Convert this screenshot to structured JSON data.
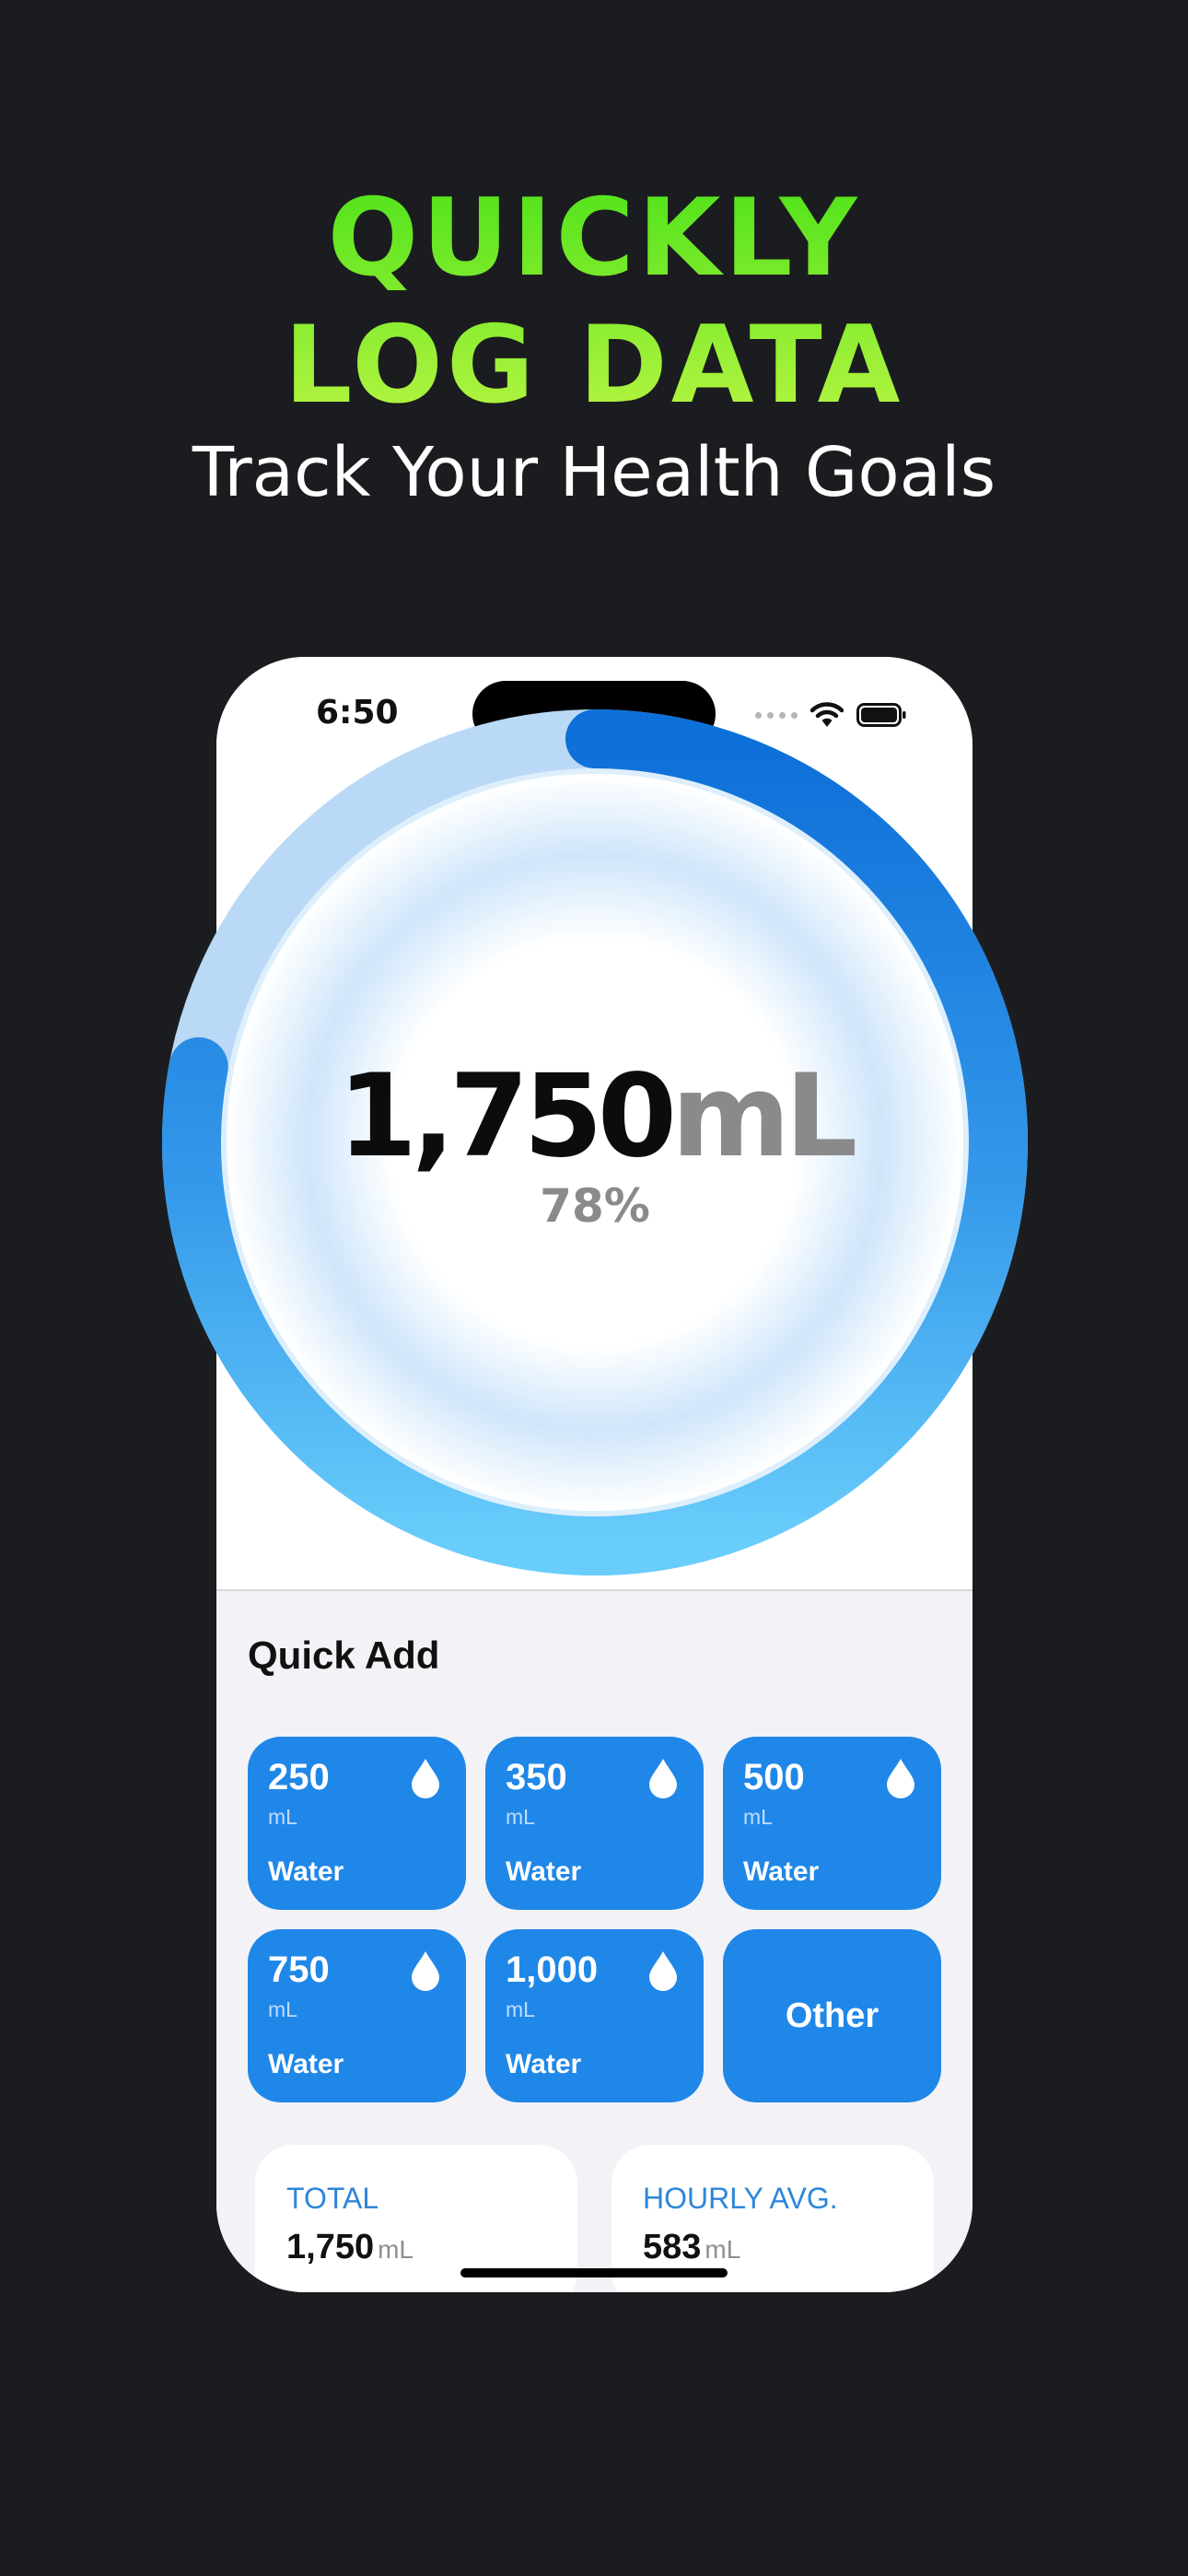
{
  "headline": {
    "line1": "QUICKLY",
    "line2": "LOG DATA",
    "subtitle": "Track Your Health Goals"
  },
  "status_bar": {
    "time": "6:50"
  },
  "ring": {
    "amount": "1,750",
    "unit": "mL",
    "percent_label": "78%",
    "progress": 0.78
  },
  "quick_add": {
    "title": "Quick Add",
    "tiles": [
      {
        "amount": "250",
        "unit": "mL",
        "kind": "Water"
      },
      {
        "amount": "350",
        "unit": "mL",
        "kind": "Water"
      },
      {
        "amount": "500",
        "unit": "mL",
        "kind": "Water"
      },
      {
        "amount": "750",
        "unit": "mL",
        "kind": "Water"
      },
      {
        "amount": "1,000",
        "unit": "mL",
        "kind": "Water"
      }
    ],
    "other_label": "Other"
  },
  "stats": {
    "total": {
      "label": "TOTAL",
      "value": "1,750",
      "unit": "mL"
    },
    "hourly": {
      "label": "HOURLY AVG.",
      "value": "583",
      "unit": "mL"
    }
  },
  "colors": {
    "background": "#1b1c1f",
    "headline_green": "#4ee21a",
    "accent_blue": "#1f87e8",
    "ring_track": "#b9d9f6"
  },
  "icons": [
    "wifi-icon",
    "battery-icon",
    "water-drop-icon"
  ]
}
